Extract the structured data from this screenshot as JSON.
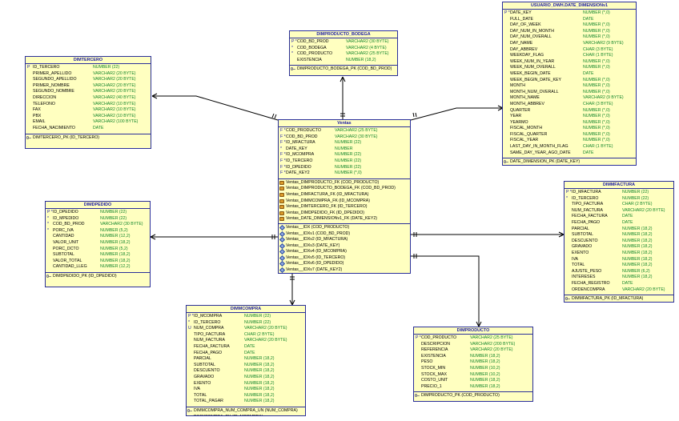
{
  "entities": {
    "dimtercero": {
      "title": "DIMTERCERO",
      "columns": [
        {
          "m": "P",
          "n": "ID_TERCERO",
          "t": "NUMBER (22)"
        },
        {
          "m": "",
          "n": "PRIMER_APELLIDO",
          "t": "VARCHAR2 (20 BYTE)"
        },
        {
          "m": "",
          "n": "SEGUNDO_APELLIDO",
          "t": "VARCHAR2 (20 BYTE)"
        },
        {
          "m": "",
          "n": "PRIMER_NOMBRE",
          "t": "VARCHAR2 (20 BYTE)"
        },
        {
          "m": "",
          "n": "SEGUNDO_NOMBRE",
          "t": "VARCHAR2 (20 BYTE)"
        },
        {
          "m": "",
          "n": "DIRECCION",
          "t": "VARCHAR2 (40 BYTE)"
        },
        {
          "m": "",
          "n": "TELEFONO",
          "t": "VARCHAR2 (10 BYTE)"
        },
        {
          "m": "",
          "n": "FAX",
          "t": "VARCHAR2 (10 BYTE)"
        },
        {
          "m": "",
          "n": "PBX",
          "t": "VARCHAR2 (10 BYTE)"
        },
        {
          "m": "",
          "n": "EMAIL",
          "t": "VARCHAR2 (100 BYTE)"
        },
        {
          "m": "",
          "n": "FECHA_NACIMIENTO",
          "t": "DATE"
        }
      ],
      "keys": [
        "DIMTERCERO_PK (ID_TERCERO)"
      ]
    },
    "dimproducto_bodega": {
      "title": "DIMPRODUCTO_BODEGA",
      "columns": [
        {
          "m": "P *",
          "n": "COD_BD_PROD",
          "t": "VARCHAR2 (30 BYTE)"
        },
        {
          "m": "*",
          "n": "COD_BODEGA",
          "t": "VARCHAR2 (4 BYTE)"
        },
        {
          "m": "*",
          "n": "COD_PRODUCTO",
          "t": "VARCHAR2 (25 BYTE)"
        },
        {
          "m": "",
          "n": "EXISTENCIA",
          "t": "NUMBER (18,2)"
        }
      ],
      "keys": [
        "DIMPRODUCTO_BODEGA_PK (COD_BD_PROD)"
      ]
    },
    "usuario_dwh": {
      "title": "USUARIO_DWH.DATE_DIMENSIONv1",
      "columns": [
        {
          "m": "P *",
          "n": "DATE_KEY",
          "t": "NUMBER (*,0)"
        },
        {
          "m": "",
          "n": "FULL_DATE",
          "t": "DATE"
        },
        {
          "m": "",
          "n": "DAY_OF_WEEK",
          "t": "NUMBER (*,0)"
        },
        {
          "m": "",
          "n": "DAY_NUM_IN_MONTH",
          "t": "NUMBER (*,0)"
        },
        {
          "m": "",
          "n": "DAY_NUM_OVERALL",
          "t": "NUMBER (*,0)"
        },
        {
          "m": "",
          "n": "DAY_NAME",
          "t": "VARCHAR2 (9 BYTE)"
        },
        {
          "m": "",
          "n": "DAY_ABBREV",
          "t": "CHAR (3 BYTE)"
        },
        {
          "m": "",
          "n": "WEEKDAY_FLAG",
          "t": "CHAR (1 BYTE)"
        },
        {
          "m": "",
          "n": "WEEK_NUM_IN_YEAR",
          "t": "NUMBER (*,0)"
        },
        {
          "m": "",
          "n": "WEEK_NUM_OVERALL",
          "t": "NUMBER (*,0)"
        },
        {
          "m": "",
          "n": "WEEK_BEGIN_DATE",
          "t": "DATE"
        },
        {
          "m": "",
          "n": "WEEK_BEGIN_DATE_KEY",
          "t": "NUMBER (*,0)"
        },
        {
          "m": "",
          "n": "MONTH",
          "t": "NUMBER (*,0)"
        },
        {
          "m": "",
          "n": "MONTH_NUM_OVERALL",
          "t": "NUMBER (*,0)"
        },
        {
          "m": "",
          "n": "MONTH_NAME",
          "t": "VARCHAR2 (9 BYTE)"
        },
        {
          "m": "",
          "n": "MONTH_ABBREV",
          "t": "CHAR (3 BYTE)"
        },
        {
          "m": "",
          "n": "QUARTER",
          "t": "NUMBER (*,0)"
        },
        {
          "m": "",
          "n": "YEAR",
          "t": "NUMBER (*,0)"
        },
        {
          "m": "",
          "n": "YEARMO",
          "t": "NUMBER (*,0)"
        },
        {
          "m": "",
          "n": "FISCAL_MONTH",
          "t": "NUMBER (*,0)"
        },
        {
          "m": "",
          "n": "FISCAL_QUARTER",
          "t": "NUMBER (*,0)"
        },
        {
          "m": "",
          "n": "FISCAL_YEAR",
          "t": "NUMBER (*,0)"
        },
        {
          "m": "",
          "n": "LAST_DAY_IN_MONTH_FLAG",
          "t": "CHAR (1 BYTE)"
        },
        {
          "m": "",
          "n": "SAME_DAY_YEAR_AGO_DATE",
          "t": "DATE"
        }
      ],
      "keys": [
        "DATE_DIMENSION_PK (DATE_KEY)"
      ]
    },
    "ventas": {
      "title": "Ventas",
      "columns": [
        {
          "m": "F *",
          "n": "COD_PRODUCTO",
          "t": "VARCHAR2 (25 BYTE)"
        },
        {
          "m": "F *",
          "n": "COD_BD_PROD",
          "t": "VARCHAR2 (30 BYTE)"
        },
        {
          "m": "F *",
          "n": "ID_MFACTURA",
          "t": "NUMBER (22)"
        },
        {
          "m": "*",
          "n": "DATE_KEY",
          "t": "NUMBER"
        },
        {
          "m": "F *",
          "n": "ID_MCOMPRA",
          "t": "NUMBER (22)"
        },
        {
          "m": "F *",
          "n": "ID_TERCERO",
          "t": "NUMBER (22)"
        },
        {
          "m": "F *",
          "n": "ID_DPEDIDO",
          "t": "NUMBER (22)"
        },
        {
          "m": "F *",
          "n": "DATE_KEY2",
          "t": "NUMBER (*,0)"
        }
      ],
      "fks": [
        "Ventas_DIMPRODUCTO_FK (COD_PRODUCTO)",
        "Ventas_DIMPRODUCTO_BODEGA_FK (COD_BD_PROD)",
        "Ventas_DIMFACTURA_FK (ID_MFACTURA)",
        "Ventas_DIMMCOMPRA_FK (ID_MCOMPRA)",
        "Ventas_DIMTERCERO_FK (ID_TERCERO)",
        "Ventas_DIMDPEDIDO_FK (ID_DPEDIDO)",
        "Ventas_DATE_DIMENSIONv1_FK (DATE_KEY2)"
      ],
      "indexes": [
        "Ventas__IDX (COD_PRODUCTO)",
        "Ventas__IDXv1 (COD_BD_PROD)",
        "Ventas__IDXv2 (ID_MFACTURA)",
        "Ventas__IDXv3 (DATE_KEY)",
        "Ventas__IDXv4 (ID_MCOMPRA)",
        "Ventas__IDXv5 (ID_TERCERO)",
        "Ventas__IDXv6 (ID_DPEDIDO)",
        "Ventas__IDXv7 (DATE_KEY2)"
      ]
    },
    "dimpedido": {
      "title": "DIMDPEDIDO",
      "columns": [
        {
          "m": "P *",
          "n": "ID_DPEDIDO",
          "t": "NUMBER (22)"
        },
        {
          "m": "*",
          "n": "ID_MPEDIDO",
          "t": "NUMBER (22)"
        },
        {
          "m": "*",
          "n": "COD_BD_PROD",
          "t": "VARCHAR2 (30 BYTE)"
        },
        {
          "m": "*",
          "n": "PORC_IVA",
          "t": "NUMBER (5,2)"
        },
        {
          "m": "",
          "n": "CANTIDAD",
          "t": "NUMBER (12,2)"
        },
        {
          "m": "",
          "n": "VALOR_UNIT",
          "t": "NUMBER (18,2)"
        },
        {
          "m": "",
          "n": "PORC_DCTO",
          "t": "NUMBER (5,2)"
        },
        {
          "m": "",
          "n": "SUBTOTAL",
          "t": "NUMBER (18,2)"
        },
        {
          "m": "",
          "n": "VALOR_TOTAL",
          "t": "NUMBER (18,2)"
        },
        {
          "m": "",
          "n": "CANTIDAD_LLEG",
          "t": "NUMBER (12,2)"
        }
      ],
      "keys": [
        "DIMDPEDIDO_PK (ID_DPEDIDO)"
      ]
    },
    "dimfactura": {
      "title": "DIMMFACTURA",
      "columns": [
        {
          "m": "P *",
          "n": "ID_MFACTURA",
          "t": "NUMBER (22)"
        },
        {
          "m": "*",
          "n": "ID_TERCERO",
          "t": "NUMBER (22)"
        },
        {
          "m": "",
          "n": "TIPO_FACTURA",
          "t": "CHAR (2 BYTE)"
        },
        {
          "m": "",
          "n": "NUM_FACTURA",
          "t": "VARCHAR2 (20 BYTE)"
        },
        {
          "m": "",
          "n": "FECHA_FACTURA",
          "t": "DATE"
        },
        {
          "m": "",
          "n": "FECHA_PAGO",
          "t": "DATE"
        },
        {
          "m": "",
          "n": "PARCIAL",
          "t": "NUMBER (18,2)"
        },
        {
          "m": "",
          "n": "SUBTOTAL",
          "t": "NUMBER (18,2)"
        },
        {
          "m": "",
          "n": "DESCUENTO",
          "t": "NUMBER (18,2)"
        },
        {
          "m": "",
          "n": "GRAVADO",
          "t": "NUMBER (18,2)"
        },
        {
          "m": "",
          "n": "EXENTO",
          "t": "NUMBER (18,2)"
        },
        {
          "m": "",
          "n": "IVA",
          "t": "NUMBER (18,2)"
        },
        {
          "m": "",
          "n": "TOTAL",
          "t": "NUMBER (18,2)"
        },
        {
          "m": "",
          "n": "AJUSTE_PESO",
          "t": "NUMBER (6,2)"
        },
        {
          "m": "",
          "n": "INTERESES",
          "t": "NUMBER (18,2)"
        },
        {
          "m": "",
          "n": "FECHA_REGISTRO",
          "t": "DATE"
        },
        {
          "m": "",
          "n": "ORDENCOMPRA",
          "t": "VARCHAR2 (20 BYTE)"
        }
      ],
      "keys": [
        "DIMMFACTURA_PK (ID_MFACTURA)"
      ]
    },
    "dimcompra": {
      "title": "DIMMCOMPRA",
      "columns": [
        {
          "m": "P *",
          "n": "ID_MCOMPRA",
          "t": "NUMBER (22)"
        },
        {
          "m": "*",
          "n": "ID_TERCERO",
          "t": "NUMBER (22)"
        },
        {
          "m": "U",
          "n": "NUM_COMPRA",
          "t": "VARCHAR2 (20 BYTE)"
        },
        {
          "m": "",
          "n": "TIPO_FACTURA",
          "t": "CHAR (2 BYTE)"
        },
        {
          "m": "",
          "n": "NUM_FACTURA",
          "t": "VARCHAR2 (20 BYTE)"
        },
        {
          "m": "",
          "n": "FECHA_FACTURA",
          "t": "DATE"
        },
        {
          "m": "",
          "n": "FECHA_PAGO",
          "t": "DATE"
        },
        {
          "m": "",
          "n": "PARCIAL",
          "t": "NUMBER (18,2)"
        },
        {
          "m": "",
          "n": "SUBTOTAL",
          "t": "NUMBER (18,2)"
        },
        {
          "m": "",
          "n": "DESCUENTO",
          "t": "NUMBER (18,2)"
        },
        {
          "m": "",
          "n": "GRAVADO",
          "t": "NUMBER (18,2)"
        },
        {
          "m": "",
          "n": "EXENTO",
          "t": "NUMBER (18,2)"
        },
        {
          "m": "",
          "n": "IVA",
          "t": "NUMBER (18,2)"
        },
        {
          "m": "",
          "n": "TOTAL",
          "t": "NUMBER (18,2)"
        },
        {
          "m": "",
          "n": "TOTAL_PAGAR",
          "t": "NUMBER (18,2)"
        }
      ],
      "keys": [
        "DIMMCOMPRA_NUM_COMPRA_UN (NUM_COMPRA)",
        "DIMMCOMPRA_PK (ID_MCOMPRA)"
      ]
    },
    "dimproducto": {
      "title": "DIMPRODUCTO",
      "columns": [
        {
          "m": "P *",
          "n": "COD_PRODUCTO",
          "t": "VARCHAR2 (25 BYTE)"
        },
        {
          "m": "",
          "n": "DESCRIPCION",
          "t": "VARCHAR2 (200 BYTE)"
        },
        {
          "m": "",
          "n": "REFERENCIA",
          "t": "VARCHAR2 (20 BYTE)"
        },
        {
          "m": "",
          "n": "EXISTENCIA",
          "t": "NUMBER (18,2)"
        },
        {
          "m": "",
          "n": "PESO",
          "t": "NUMBER (18,2)"
        },
        {
          "m": "",
          "n": "STOCK_MIN",
          "t": "NUMBER (10,2)"
        },
        {
          "m": "",
          "n": "STOCK_MAX",
          "t": "NUMBER (10,2)"
        },
        {
          "m": "",
          "n": "COSTO_UNIT",
          "t": "NUMBER (18,2)"
        },
        {
          "m": "",
          "n": "PRECIO_1",
          "t": "NUMBER (18,2)"
        }
      ],
      "keys": [
        "DIMPRODUCTO_PK (COD_PRODUCTO)"
      ]
    }
  }
}
